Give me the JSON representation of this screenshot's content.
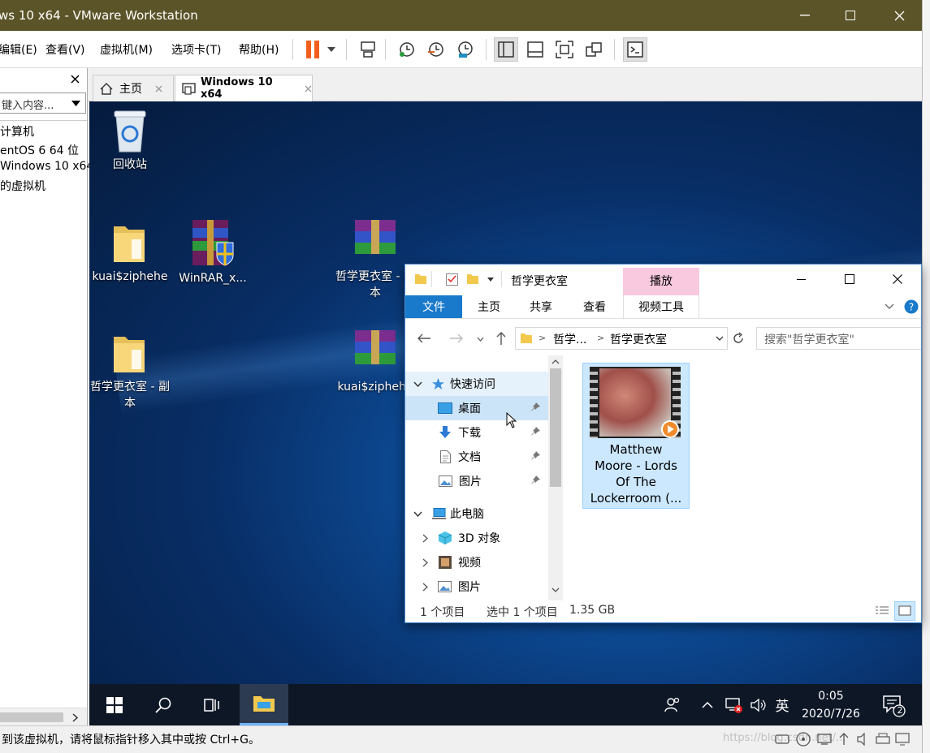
{
  "window": {
    "title": "ws 10 x64 - VMware Workstation"
  },
  "menu": [
    {
      "label": "编辑(E)"
    },
    {
      "label": "查看(V)"
    },
    {
      "label": "虚拟机(M)"
    },
    {
      "label": "选项卡(T)"
    },
    {
      "label": "帮助(H)"
    }
  ],
  "library": {
    "search_placeholder": "键入内容...",
    "items": [
      "计算机",
      "entOS 6 64 位",
      "Windows 10 x64",
      "的虚拟机"
    ]
  },
  "vm_tabs": [
    {
      "label": "主页"
    },
    {
      "label": "Windows 10 x64"
    }
  ],
  "desktop": {
    "icons": [
      {
        "label": "回收站",
        "icon": "recycle-bin-icon"
      },
      {
        "label": "kuai$ziphehe",
        "icon": "folder-icon"
      },
      {
        "label": "WinRAR_x...",
        "icon": "winrar-installer-icon"
      },
      {
        "label": "哲学更衣室 - 副本",
        "icon": "rar-archive-icon"
      },
      {
        "label": "哲学更衣室 - 副本",
        "icon": "folder-icon"
      },
      {
        "label": "kuai$ziphehe",
        "icon": "rar-archive-icon"
      }
    ]
  },
  "explorer": {
    "title": "哲学更衣室",
    "context_tab": "播放",
    "ribbon_tabs": [
      "文件",
      "主页",
      "共享",
      "查看",
      "视频工具"
    ],
    "breadcrumb": [
      "哲学...",
      "哲学更衣室"
    ],
    "search_placeholder": "搜索\"哲学更衣室\"",
    "nav": [
      {
        "label": "快速访问",
        "level": 0,
        "icon": "star-icon",
        "expander": "expanded"
      },
      {
        "label": "桌面",
        "level": 1,
        "icon": "desktop-icon",
        "pinned": true,
        "selected": true
      },
      {
        "label": "下载",
        "level": 1,
        "icon": "download-icon",
        "pinned": true
      },
      {
        "label": "文档",
        "level": 1,
        "icon": "document-icon",
        "pinned": true
      },
      {
        "label": "图片",
        "level": 1,
        "icon": "pictures-icon",
        "pinned": true
      },
      {
        "label": "此电脑",
        "level": 0,
        "icon": "computer-icon",
        "expander": "expanded"
      },
      {
        "label": "3D 对象",
        "level": 1,
        "icon": "3d-objects-icon",
        "expander": "collapsed"
      },
      {
        "label": "视频",
        "level": 1,
        "icon": "videos-icon",
        "expander": "collapsed"
      },
      {
        "label": "图片",
        "level": 1,
        "icon": "pictures-icon",
        "expander": "collapsed"
      }
    ],
    "file": {
      "name_lines": [
        "Matthew",
        "Moore - Lords",
        "Of The",
        "Lockerroom (..."
      ]
    },
    "status": {
      "count": "1 个项目",
      "selection": "选中 1 个项目",
      "size": "1.35 GB"
    }
  },
  "taskbar": {
    "ime": "英",
    "time": "0:05",
    "date": "2020/7/26",
    "notifications": "2"
  },
  "vm_status": "到该虚拟机，请将鼠标指针移入其中或按 Ctrl+G。",
  "watermark": "https://blog.csdn.net/...",
  "colors": {
    "titlebar": "#5b5428",
    "ribbon_file": "#1979ca",
    "context": "#f9c9e0",
    "selection": "#cce4f7",
    "pause": "#f25f1c"
  }
}
